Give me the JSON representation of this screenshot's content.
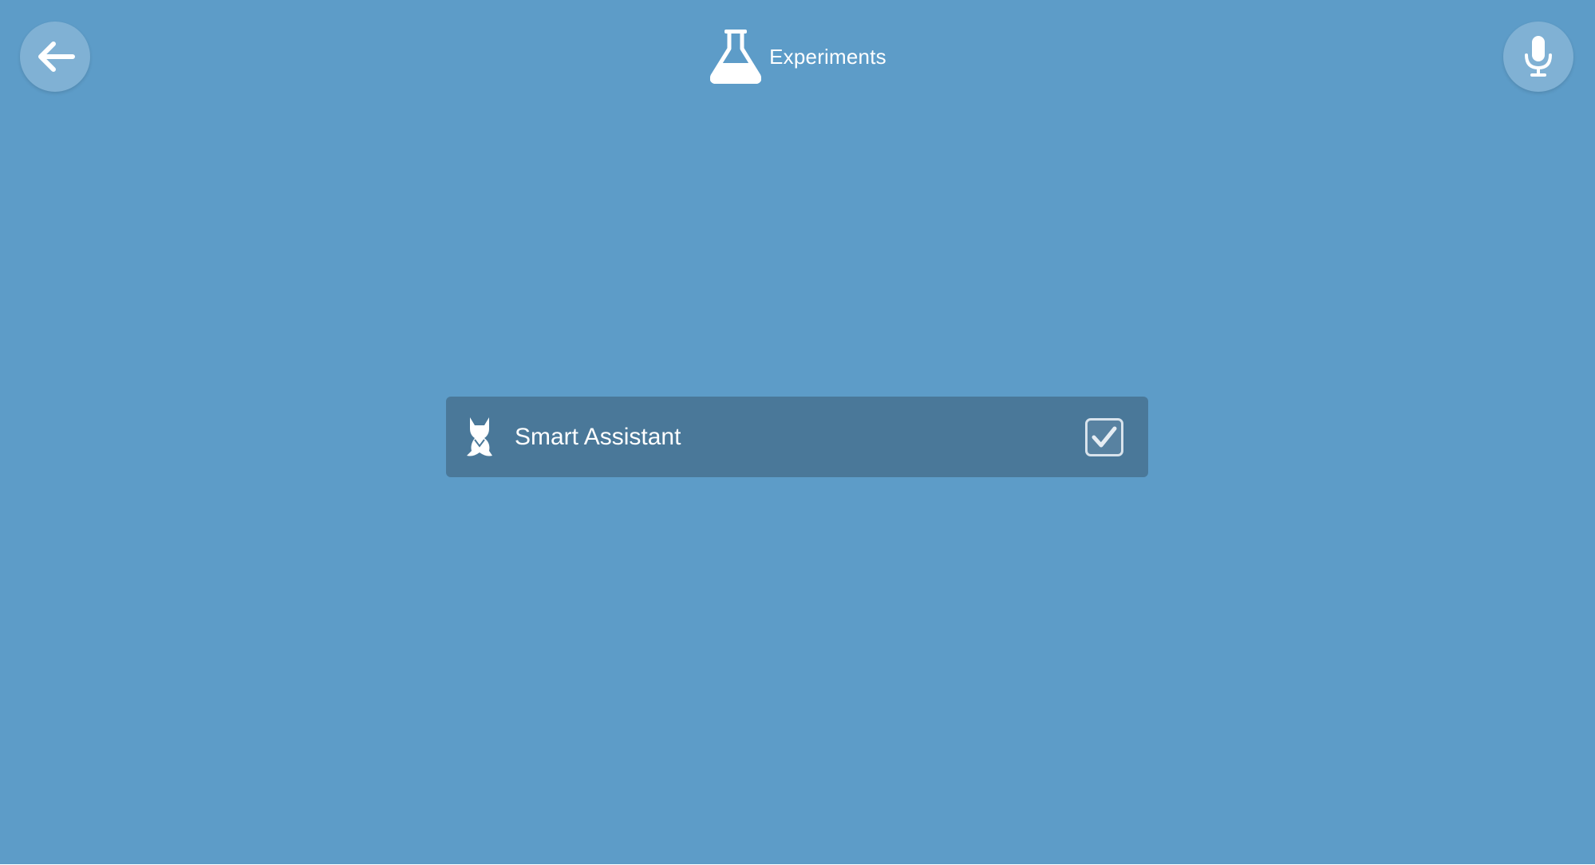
{
  "header": {
    "title": "Experiments",
    "icon": "flask-icon"
  },
  "toolbar": {
    "back_icon": "arrow-left-icon",
    "mic_icon": "microphone-icon"
  },
  "experiments": [
    {
      "label": "Smart Assistant",
      "icon": "fox-icon",
      "checked": true
    }
  ],
  "colors": {
    "background": "#5d9cc8",
    "row_background": "#4a7899",
    "text": "#ffffff"
  }
}
